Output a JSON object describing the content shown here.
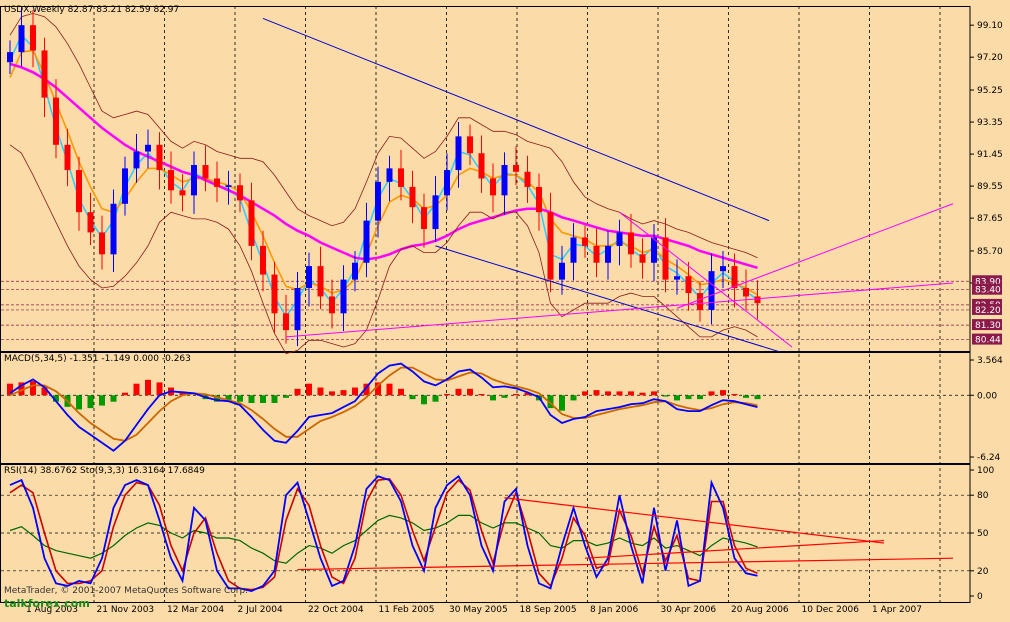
{
  "window": {
    "symbol_header": "USDX,Weekly  82.87 83.21 82.59 82.97",
    "copyright": "MetaTrader, © 2001-2007 MetaQuotes Software Corp.",
    "watermark": "talkforex.com"
  },
  "colors": {
    "background": "#fbdca8",
    "bull_candle": "#0000ff",
    "bear_candle": "#ff0000",
    "ma_fast": "#33ccff",
    "ma_mid": "#ff9900",
    "ma_slow": "#ff00ff",
    "bollinger": "#8b1a1a",
    "channel": "#0000cc",
    "macd_line": "#0000ff",
    "signal_line": "#cc6600",
    "hist_pos": "#ff0000",
    "hist_neg": "#009900",
    "rsi": "#006600",
    "stoch_k": "#0000ff",
    "stoch_d": "#cc0000"
  },
  "chart_data": [
    {
      "type": "candlestick",
      "title": "USDX,Weekly  82.87 83.21 82.59 82.97",
      "y_ticks": [
        "99.10",
        "97.20",
        "95.25",
        "93.35",
        "91.45",
        "89.55",
        "87.65",
        "85.70",
        "83.80"
      ],
      "ylim": [
        80.0,
        100.0
      ],
      "price_labels": [
        "83.90",
        "83.40",
        "82.50",
        "82.20",
        "81.30",
        "80.44"
      ],
      "x_tick_labels": [
        "1 Aug 2003",
        "21 Nov 2003",
        "12 Mar 2004",
        "2 Jul 2004",
        "22 Oct 2004",
        "11 Feb 2005",
        "30 May 2005",
        "18 Sep 2005",
        "8 Jan 2006",
        "30 Apr 2006",
        "20 Aug 2006",
        "10 Dec 2006",
        "1 Apr 2007"
      ],
      "close_path": [
        97.5,
        99.1,
        97.6,
        94.8,
        92.0,
        90.5,
        88.0,
        86.8,
        85.5,
        88.5,
        90.6,
        91.6,
        92.0,
        90.5,
        89.3,
        89.0,
        90.8,
        90.0,
        89.5,
        89.6,
        88.7,
        86.0,
        84.3,
        82.0,
        81.0,
        83.5,
        84.8,
        83.0,
        82.0,
        84.0,
        85.0,
        87.5,
        89.8,
        90.6,
        89.5,
        88.3,
        87.0,
        89.0,
        90.5,
        92.5,
        91.5,
        90.0,
        89.0,
        90.8,
        90.4,
        89.5,
        88.0,
        84.0,
        85.0,
        86.5,
        86.0,
        85.0,
        86.0,
        86.8,
        85.5,
        85.0,
        86.5,
        84.0,
        84.2,
        83.2,
        82.2,
        84.5,
        84.8,
        83.5,
        83.0,
        82.6
      ],
      "series": [
        {
          "kind": "ma_fast",
          "values": [
            97.0,
            98.5,
            97.8,
            95.5,
            93.0,
            91.0,
            88.8,
            87.5,
            86.5,
            87.5,
            89.5,
            90.8,
            91.5,
            90.8,
            89.8,
            89.3,
            90.3,
            90.0,
            89.6,
            89.4,
            88.8,
            86.8,
            85.0,
            83.0,
            81.8,
            82.8,
            84.0,
            83.5,
            82.6,
            83.5,
            84.6,
            86.8,
            88.8,
            90.0,
            89.7,
            88.8,
            87.6,
            88.5,
            89.8,
            91.6,
            91.4,
            90.4,
            89.5,
            90.3,
            90.2,
            89.6,
            88.5,
            85.5,
            85.2,
            86.1,
            86.0,
            85.4,
            85.8,
            86.4,
            85.8,
            85.3,
            86.0,
            84.8,
            84.4,
            83.7,
            82.9,
            83.8,
            84.4,
            83.9,
            83.3,
            82.8
          ]
        },
        {
          "kind": "ma_mid",
          "values": [
            96.0,
            97.5,
            97.6,
            96.2,
            94.5,
            92.8,
            91.0,
            89.5,
            88.2,
            88.0,
            88.8,
            89.8,
            90.6,
            90.6,
            90.2,
            89.8,
            90.0,
            90.0,
            89.8,
            89.6,
            89.2,
            88.0,
            86.6,
            85.0,
            83.6,
            83.4,
            83.8,
            83.6,
            83.2,
            83.4,
            84.0,
            85.5,
            87.2,
            88.6,
            89.0,
            88.8,
            88.2,
            88.4,
            89.0,
            90.2,
            90.6,
            90.4,
            90.0,
            90.2,
            90.2,
            89.8,
            89.2,
            87.6,
            86.8,
            86.6,
            86.4,
            86.0,
            86.0,
            86.2,
            86.0,
            85.6,
            85.8,
            85.2,
            84.8,
            84.3,
            83.7,
            83.8,
            84.0,
            83.8,
            83.5,
            83.1
          ]
        },
        {
          "kind": "ma_slow",
          "values": [
            96.8,
            96.6,
            96.3,
            95.9,
            95.4,
            94.8,
            94.2,
            93.6,
            93.0,
            92.5,
            92.0,
            91.6,
            91.3,
            91.0,
            90.7,
            90.4,
            90.2,
            89.9,
            89.6,
            89.3,
            89.0,
            88.6,
            88.2,
            87.8,
            87.3,
            86.9,
            86.6,
            86.2,
            85.9,
            85.6,
            85.3,
            85.2,
            85.3,
            85.5,
            85.8,
            86.0,
            86.1,
            86.3,
            86.6,
            87.0,
            87.3,
            87.5,
            87.7,
            87.9,
            88.1,
            88.2,
            88.2,
            88.0,
            87.7,
            87.5,
            87.3,
            87.1,
            86.9,
            86.8,
            86.7,
            86.6,
            86.6,
            86.4,
            86.2,
            86.0,
            85.7,
            85.5,
            85.3,
            85.1,
            84.9,
            84.7
          ]
        },
        {
          "kind": "boll_upper",
          "values": [
            98.5,
            99.6,
            99.8,
            99.6,
            99.0,
            98.0,
            96.8,
            95.4,
            94.0,
            93.6,
            93.8,
            94.0,
            93.8,
            93.0,
            92.2,
            91.8,
            92.2,
            92.0,
            91.6,
            91.4,
            91.2,
            91.2,
            91.0,
            90.2,
            89.2,
            88.2,
            87.8,
            87.5,
            87.2,
            87.4,
            88.2,
            89.8,
            91.5,
            92.5,
            92.4,
            91.8,
            91.2,
            91.6,
            92.5,
            93.6,
            93.6,
            93.2,
            92.8,
            92.8,
            92.6,
            92.2,
            92.0,
            91.8,
            91.0,
            89.8,
            88.9,
            88.5,
            88.2,
            88.0,
            87.6,
            87.3,
            87.5,
            87.3,
            87.0,
            86.8,
            86.5,
            86.2,
            86.0,
            85.8,
            85.6,
            85.3
          ]
        },
        {
          "kind": "boll_lower",
          "values": [
            92.0,
            91.5,
            90.2,
            88.8,
            87.4,
            86.0,
            84.8,
            84.0,
            83.5,
            83.6,
            84.2,
            85.0,
            86.0,
            87.4,
            88.0,
            87.8,
            87.6,
            87.6,
            87.4,
            87.0,
            86.0,
            84.5,
            82.6,
            80.8,
            79.6,
            79.8,
            80.4,
            80.4,
            80.2,
            80.0,
            80.2,
            81.0,
            82.8,
            84.8,
            85.8,
            86.0,
            85.6,
            85.6,
            86.2,
            87.2,
            88.0,
            88.0,
            87.6,
            88.0,
            88.0,
            87.2,
            85.6,
            82.6,
            81.8,
            82.2,
            82.6,
            82.6,
            82.6,
            83.0,
            83.2,
            83.0,
            83.0,
            82.4,
            81.8,
            81.2,
            80.6,
            80.6,
            81.0,
            81.2,
            81.0,
            80.6
          ]
        }
      ],
      "trend_lines": [
        {
          "color": "channel",
          "from": [
            22,
            99.5
          ],
          "to": [
            66,
            87.5
          ]
        },
        {
          "color": "channel",
          "from": [
            37,
            86.0
          ],
          "to": [
            67,
            79.7
          ]
        },
        {
          "color": "ma_slow",
          "from": [
            24,
            80.6
          ],
          "to": [
            82,
            83.8
          ]
        },
        {
          "color": "ma_slow",
          "from": [
            53,
            88.0
          ],
          "to": [
            68,
            80.0
          ]
        },
        {
          "color": "ma_slow",
          "from": [
            58,
            82.3
          ],
          "to": [
            82,
            88.5
          ]
        }
      ]
    },
    {
      "type": "bar",
      "title": "MACD(5,34,5) -1.351 -1.149 0.000 -0.263",
      "y_ticks": [
        "3.564",
        "0.00",
        "-6.24"
      ],
      "ylim": [
        -6.24,
        3.564
      ],
      "macd": [
        0.2,
        1.0,
        1.6,
        0.8,
        -0.6,
        -2.0,
        -3.2,
        -4.0,
        -4.8,
        -5.6,
        -4.6,
        -3.0,
        -1.4,
        0.0,
        0.4,
        0.3,
        0.2,
        -0.2,
        -0.5,
        -0.6,
        -1.0,
        -2.2,
        -3.5,
        -4.6,
        -4.8,
        -3.6,
        -2.2,
        -2.0,
        -1.8,
        -1.2,
        -0.6,
        0.8,
        2.2,
        3.0,
        3.2,
        2.4,
        1.4,
        1.0,
        1.6,
        2.4,
        2.6,
        1.8,
        0.8,
        0.9,
        0.7,
        0.3,
        -0.2,
        -2.0,
        -2.8,
        -2.4,
        -2.2,
        -1.6,
        -1.4,
        -1.2,
        -0.9,
        -0.8,
        -0.4,
        -0.6,
        -1.4,
        -1.6,
        -1.6,
        -1.0,
        -0.5,
        -0.6,
        -0.9,
        -1.2
      ],
      "signal": [
        0.0,
        0.5,
        1.0,
        1.0,
        0.4,
        -0.6,
        -1.8,
        -2.8,
        -3.6,
        -4.4,
        -4.6,
        -4.0,
        -2.8,
        -1.6,
        -0.6,
        0.0,
        0.2,
        0.1,
        -0.2,
        -0.5,
        -0.8,
        -1.5,
        -2.4,
        -3.4,
        -4.2,
        -4.2,
        -3.4,
        -2.6,
        -2.2,
        -1.7,
        -1.1,
        -0.2,
        1.0,
        2.0,
        2.8,
        2.8,
        2.2,
        1.6,
        1.5,
        1.9,
        2.3,
        2.2,
        1.6,
        1.2,
        0.9,
        0.6,
        0.2,
        -0.8,
        -1.9,
        -2.3,
        -2.3,
        -2.0,
        -1.7,
        -1.4,
        -1.2,
        -1.0,
        -0.7,
        -0.6,
        -1.0,
        -1.3,
        -1.5,
        -1.3,
        -0.9,
        -0.7,
        -0.8,
        -1.0
      ],
      "histogram": [
        0.9,
        1.0,
        1.1,
        0.6,
        -0.5,
        -0.9,
        -1.1,
        -1.0,
        -0.8,
        -0.5,
        0.2,
        0.9,
        1.2,
        1.0,
        0.6,
        0.3,
        0.0,
        -0.3,
        -0.5,
        -0.4,
        -0.5,
        -0.6,
        -0.6,
        -0.6,
        -0.2,
        0.5,
        0.9,
        0.6,
        0.3,
        0.4,
        0.6,
        0.9,
        1.0,
        0.9,
        0.5,
        -0.3,
        -0.7,
        -0.5,
        0.1,
        0.5,
        0.5,
        0.1,
        -0.4,
        -0.2,
        0.1,
        0.2,
        -0.4,
        -1.0,
        -1.2,
        -0.4,
        0.3,
        0.4,
        0.3,
        0.3,
        0.3,
        0.2,
        0.3,
        -0.1,
        -0.4,
        -0.3,
        -0.3,
        0.3,
        0.4,
        0.1,
        -0.2,
        -0.3
      ]
    },
    {
      "type": "line",
      "title": "RSI(14) 38.6762  Sto(9,3,3) 16.3164 17.6849",
      "y_ticks": [
        "100",
        "80",
        "50",
        "20",
        "0"
      ],
      "ylim": [
        0,
        100
      ],
      "rsi": [
        52,
        55,
        48,
        40,
        36,
        34,
        32,
        30,
        34,
        40,
        48,
        54,
        58,
        56,
        50,
        46,
        52,
        50,
        46,
        46,
        44,
        38,
        34,
        28,
        26,
        34,
        40,
        38,
        34,
        40,
        44,
        52,
        60,
        64,
        62,
        58,
        52,
        54,
        58,
        64,
        64,
        58,
        54,
        58,
        58,
        54,
        50,
        40,
        38,
        44,
        44,
        40,
        42,
        46,
        42,
        40,
        46,
        38,
        40,
        36,
        32,
        40,
        46,
        44,
        42,
        39
      ],
      "stoch_k": [
        88,
        92,
        70,
        30,
        10,
        8,
        12,
        10,
        30,
        70,
        88,
        92,
        88,
        60,
        30,
        12,
        70,
        60,
        20,
        6,
        6,
        4,
        8,
        20,
        80,
        90,
        60,
        30,
        8,
        12,
        40,
        85,
        95,
        92,
        75,
        40,
        20,
        70,
        88,
        95,
        80,
        40,
        20,
        75,
        85,
        40,
        10,
        6,
        40,
        70,
        40,
        15,
        30,
        80,
        40,
        10,
        70,
        20,
        60,
        8,
        12,
        90,
        70,
        30,
        18,
        16
      ],
      "stoch_d": [
        82,
        88,
        82,
        50,
        20,
        10,
        10,
        12,
        20,
        55,
        80,
        90,
        88,
        72,
        40,
        20,
        50,
        62,
        34,
        12,
        6,
        5,
        7,
        15,
        60,
        85,
        72,
        40,
        15,
        10,
        30,
        75,
        92,
        93,
        80,
        52,
        28,
        55,
        82,
        92,
        84,
        52,
        26,
        60,
        82,
        52,
        18,
        8,
        30,
        62,
        48,
        22,
        25,
        68,
        48,
        18,
        55,
        28,
        48,
        14,
        12,
        75,
        75,
        40,
        22,
        18
      ],
      "trend_lines": [
        {
          "from": [
            43,
            78
          ],
          "to": [
            76,
            42
          ]
        },
        {
          "from": [
            50,
            30
          ],
          "to": [
            76,
            44
          ]
        },
        {
          "from": [
            25,
            21
          ],
          "to": [
            82,
            30
          ]
        }
      ],
      "x_tick_labels": [
        "1 Aug 2003",
        "21 Nov 2003",
        "12 Mar 2004",
        "2 Jul 2004",
        "22 Oct 2004",
        "11 Feb 2005",
        "30 May 2005",
        "18 Sep 2005",
        "8 Jan 2006",
        "30 Apr 2006",
        "20 Aug 2006",
        "10 Dec 2006",
        "1 Apr 2007"
      ]
    }
  ]
}
